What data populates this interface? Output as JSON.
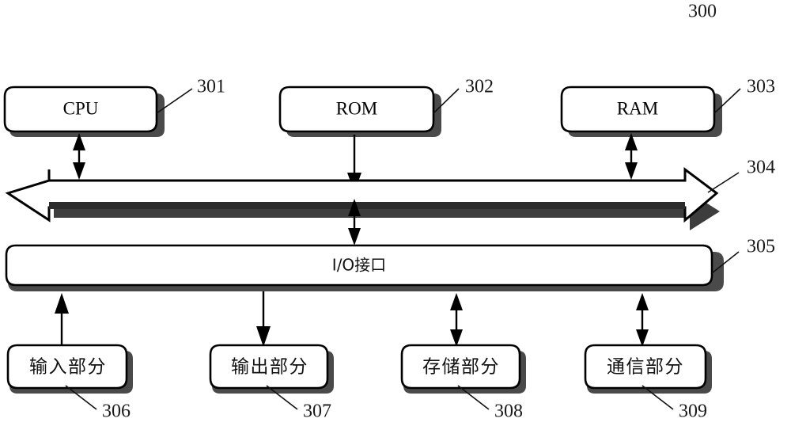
{
  "figure": {
    "figure_number": "300",
    "title_ref": "300"
  },
  "nodes": {
    "cpu": {
      "label": "CPU",
      "ref": "301"
    },
    "rom": {
      "label": "ROM",
      "ref": "302"
    },
    "ram": {
      "label": "RAM",
      "ref": "303"
    },
    "bus": {
      "label": "",
      "ref": "304"
    },
    "io": {
      "label": "I/O接口",
      "ref": "305"
    },
    "input": {
      "label": "输入部分",
      "ref": "306"
    },
    "output": {
      "label": "输出部分",
      "ref": "307"
    },
    "storage": {
      "label": "存储部分",
      "ref": "308"
    },
    "comm": {
      "label": "通信部分",
      "ref": "309"
    }
  },
  "connections": [
    {
      "from": "cpu",
      "to": "bus",
      "direction": "bidirectional"
    },
    {
      "from": "rom",
      "to": "bus",
      "direction": "down"
    },
    {
      "from": "ram",
      "to": "bus",
      "direction": "bidirectional"
    },
    {
      "from": "bus",
      "to": "io",
      "direction": "bidirectional"
    },
    {
      "from": "io",
      "to": "input",
      "direction": "up"
    },
    {
      "from": "io",
      "to": "output",
      "direction": "down"
    },
    {
      "from": "io",
      "to": "storage",
      "direction": "bidirectional"
    },
    {
      "from": "io",
      "to": "comm",
      "direction": "bidirectional"
    }
  ],
  "colors": {
    "stroke": "#000000",
    "shadow": "#4a4a4a",
    "fill": "#ffffff",
    "text": "#111111"
  }
}
